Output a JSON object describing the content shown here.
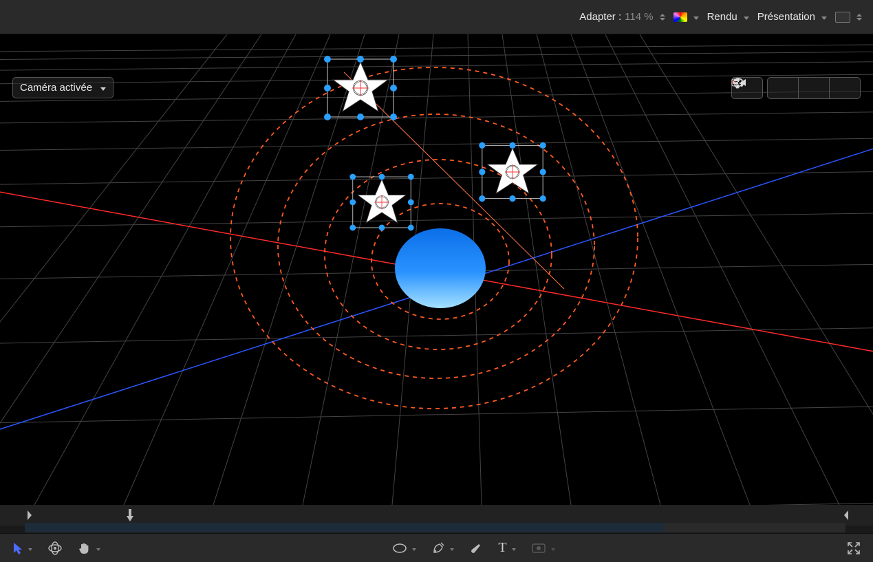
{
  "toolbar": {
    "adapter_label": "Adapter :",
    "zoom_value": "114 %",
    "color_menu": "Color",
    "render_label": "Rendu",
    "presentation_label": "Présentation",
    "safe_zones": "Zones sûres"
  },
  "overlay": {
    "camera_menu": "Caméra activée"
  },
  "view3d_controls": {
    "frame": "frame-camera",
    "pan": "pan-3d",
    "orbit": "orbit-3d",
    "dolly": "dolly-3d"
  },
  "tools": {
    "select": "select",
    "transform3d": "transform-3d",
    "hand": "hand",
    "shape": "shape-ellipse",
    "pen": "pen",
    "brush": "brush",
    "text": "T",
    "mask": "mask",
    "fullscreen": "fullscreen"
  },
  "colors": {
    "axis_x": "#ff2a2a",
    "axis_z": "#2a55ff",
    "orbit_ring": "#ff5b20",
    "handle": "#2aa0ff",
    "sphere_top": "#1680ff",
    "sphere_bottom": "#7fd1ff"
  },
  "scene": {
    "rings": 4,
    "stars": 3,
    "central_object": "sphere"
  }
}
